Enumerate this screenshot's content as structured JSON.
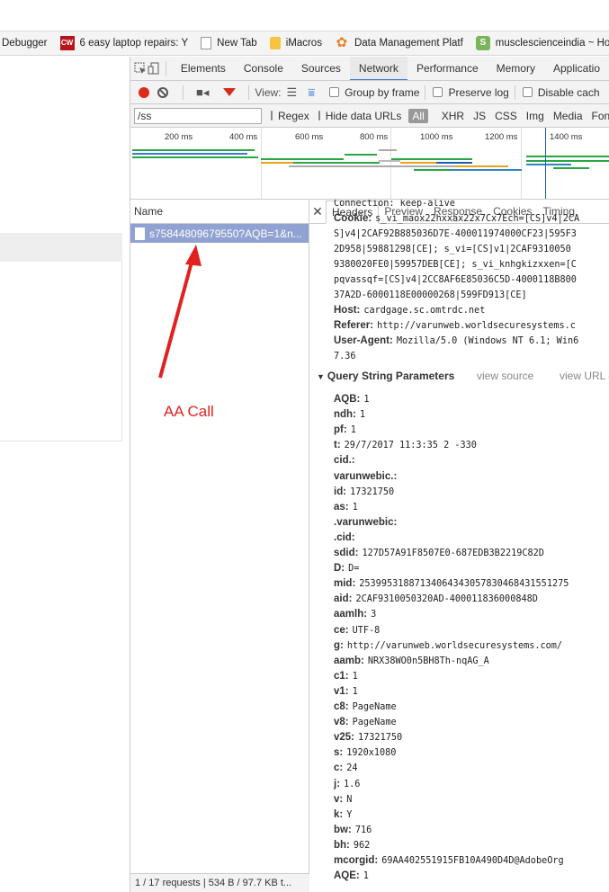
{
  "bookmarks": [
    {
      "label": "Debugger",
      "icon": "none"
    },
    {
      "label": "6 easy laptop repairs: Y",
      "icon": "cw-icon"
    },
    {
      "label": "New Tab",
      "icon": "page-icon"
    },
    {
      "label": "iMacros",
      "icon": "folder-icon"
    },
    {
      "label": "Data Management Platf",
      "icon": "flower-icon"
    },
    {
      "label": "musclescienceindia ~ Ho",
      "icon": "shop-icon"
    }
  ],
  "devtools": {
    "tabs": [
      "Elements",
      "Console",
      "Sources",
      "Network",
      "Performance",
      "Memory",
      "Applicatio"
    ],
    "active_tab": "Network",
    "toolbar": {
      "view_label": "View:",
      "group_by_frame": "Group by frame",
      "preserve_log": "Preserve log",
      "disable_cache": "Disable cach"
    },
    "filter": {
      "value": "/ss",
      "regex": "Regex",
      "hide_data_urls": "Hide data URLs",
      "types": [
        "All",
        "XHR",
        "JS",
        "CSS",
        "Img",
        "Media",
        "Font"
      ]
    },
    "overview_ticks": [
      "200 ms",
      "400 ms",
      "600 ms",
      "800 ms",
      "1000 ms",
      "1200 ms",
      "1400 ms"
    ],
    "name_header": "Name",
    "request_name": "s75844809679550?AQB=1&n...",
    "status_text": "1 / 17 requests  |  534 B / 97.7 KB t...",
    "detail_tabs": [
      "Headers",
      "Preview",
      "Response",
      "Cookies",
      "Timing"
    ],
    "active_detail_tab": "Headers",
    "request_headers": [
      {
        "key": "",
        "value": "Connection: keep-alive"
      },
      {
        "key": "Cookie:",
        "value": "s_vi_maox22hxxax22x7Cx7Ech=[CS]v4|2CA"
      },
      {
        "key": "",
        "value": "S]v4|2CAF92B885036D7E-400011974000CF23|595F3"
      },
      {
        "key": "",
        "value": "2D958|59881298[CE]; s_vi=[CS]v1|2CAF9310050"
      },
      {
        "key": "",
        "value": "9380020FE0|59957DEB[CE]; s_vi_knhgkizxxen=[C"
      },
      {
        "key": "",
        "value": "pqvassqf=[CS]v4|2CC8AF6E85036C5D-4000118B800"
      },
      {
        "key": "",
        "value": "37A2D-6000118E00000268|599FD913[CE]"
      },
      {
        "key": "Host:",
        "value": "cardgage.sc.omtrdc.net"
      },
      {
        "key": "Referer:",
        "value": "http://varunweb.worldsecuresystems.c"
      },
      {
        "key": "User-Agent:",
        "value": "Mozilla/5.0 (Windows NT 6.1; Win6"
      },
      {
        "key": "",
        "value": "7.36"
      }
    ],
    "query_section": {
      "title": "Query String Parameters",
      "view_source": "view source",
      "view_url": "view URL e"
    },
    "params": [
      {
        "key": "AQB:",
        "value": "1"
      },
      {
        "key": "ndh:",
        "value": "1"
      },
      {
        "key": "pf:",
        "value": "1"
      },
      {
        "key": "t:",
        "value": "29/7/2017 11:3:35 2 -330"
      },
      {
        "key": "cid.:",
        "value": ""
      },
      {
        "key": "varunwebic.:",
        "value": ""
      },
      {
        "key": "id:",
        "value": "17321750"
      },
      {
        "key": "as:",
        "value": "1"
      },
      {
        "key": ".varunwebic:",
        "value": ""
      },
      {
        "key": ".cid:",
        "value": ""
      },
      {
        "key": "sdid:",
        "value": "127D57A91F8507E0-687EDB3B2219C82D"
      },
      {
        "key": "D:",
        "value": "D="
      },
      {
        "key": "mid:",
        "value": "25399531887134064343057830468431551275"
      },
      {
        "key": "aid:",
        "value": "2CAF9310050320AD-400011836000848D"
      },
      {
        "key": "aamlh:",
        "value": "3"
      },
      {
        "key": "ce:",
        "value": "UTF-8"
      },
      {
        "key": "g:",
        "value": "http://varunweb.worldsecuresystems.com/"
      },
      {
        "key": "aamb:",
        "value": "NRX38WO0n5BH8Th-nqAG_A"
      },
      {
        "key": "c1:",
        "value": "1"
      },
      {
        "key": "v1:",
        "value": "1"
      },
      {
        "key": "c8:",
        "value": "PageName"
      },
      {
        "key": "v8:",
        "value": "PageName"
      },
      {
        "key": "v25:",
        "value": "17321750"
      },
      {
        "key": "s:",
        "value": "1920x1080"
      },
      {
        "key": "c:",
        "value": "24"
      },
      {
        "key": "j:",
        "value": "1.6"
      },
      {
        "key": "v:",
        "value": "N"
      },
      {
        "key": "k:",
        "value": "Y"
      },
      {
        "key": "bw:",
        "value": "716"
      },
      {
        "key": "bh:",
        "value": "962"
      },
      {
        "key": "mcorgid:",
        "value": "69AA402551915FB10A490D4D@AdobeOrg"
      },
      {
        "key": "AQE:",
        "value": "1"
      }
    ]
  },
  "annotation": {
    "label": "AA Call",
    "color": "#e0221f"
  }
}
